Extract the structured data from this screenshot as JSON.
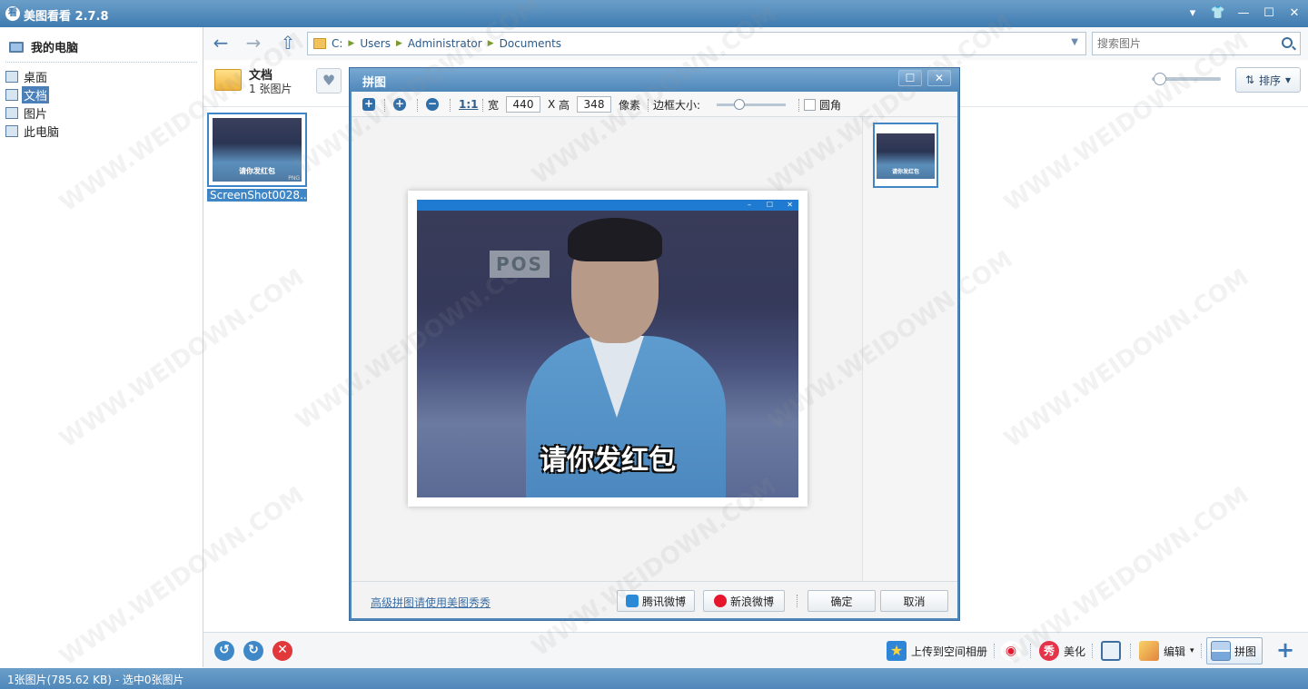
{
  "window": {
    "title": "美图看看 2.7.8",
    "app_icon_glyph": "看",
    "controls": [
      "dropdown-icon",
      "skin-icon",
      "minimize-icon",
      "maximize-icon",
      "close-icon"
    ]
  },
  "sidebar": {
    "root_label": "我的电脑",
    "items": [
      {
        "label": "桌面",
        "icon": "desktop-icon",
        "selected": false
      },
      {
        "label": "文档",
        "icon": "documents-icon",
        "selected": true
      },
      {
        "label": "图片",
        "icon": "pictures-icon",
        "selected": false
      },
      {
        "label": "此电脑",
        "icon": "computer-icon",
        "selected": false
      }
    ]
  },
  "nav": {
    "path": [
      "C:",
      "Users",
      "Administrator",
      "Documents"
    ],
    "search_placeholder": "搜索图片"
  },
  "folder": {
    "name": "文档",
    "count": "1 张图片",
    "sort_label": "排序"
  },
  "thumbnails": [
    {
      "filename": "ScreenShot0028...",
      "caption": "请你发红包",
      "badge": "PNG"
    }
  ],
  "bottom_toolbar": {
    "upload_label": "上传到空间相册",
    "beautify_label": "美化",
    "edit_label": "编辑",
    "collage_label": "拼图"
  },
  "statusbar": {
    "text": "1张图片(785.62 KB) - 选中0张图片"
  },
  "dialog": {
    "title": "拼图",
    "toolbar": {
      "actual_size_label": "1:1",
      "width_label": "宽",
      "width_value": "440",
      "x_label": "X",
      "height_label": "高",
      "height_value": "348",
      "unit_label": "像素",
      "border_label": "边框大小:",
      "border_level": 0.3,
      "rounded_label": "圆角",
      "rounded_checked": false
    },
    "preview": {
      "caption": "请你发红包",
      "sign_text": "POS"
    },
    "footer": {
      "link_text": "高级拼图请使用美图秀秀",
      "tencent_label": "腾讯微博",
      "sina_label": "新浪微博",
      "ok_label": "确定",
      "cancel_label": "取消"
    }
  },
  "watermark": "WWW.WEIDOWN.COM"
}
